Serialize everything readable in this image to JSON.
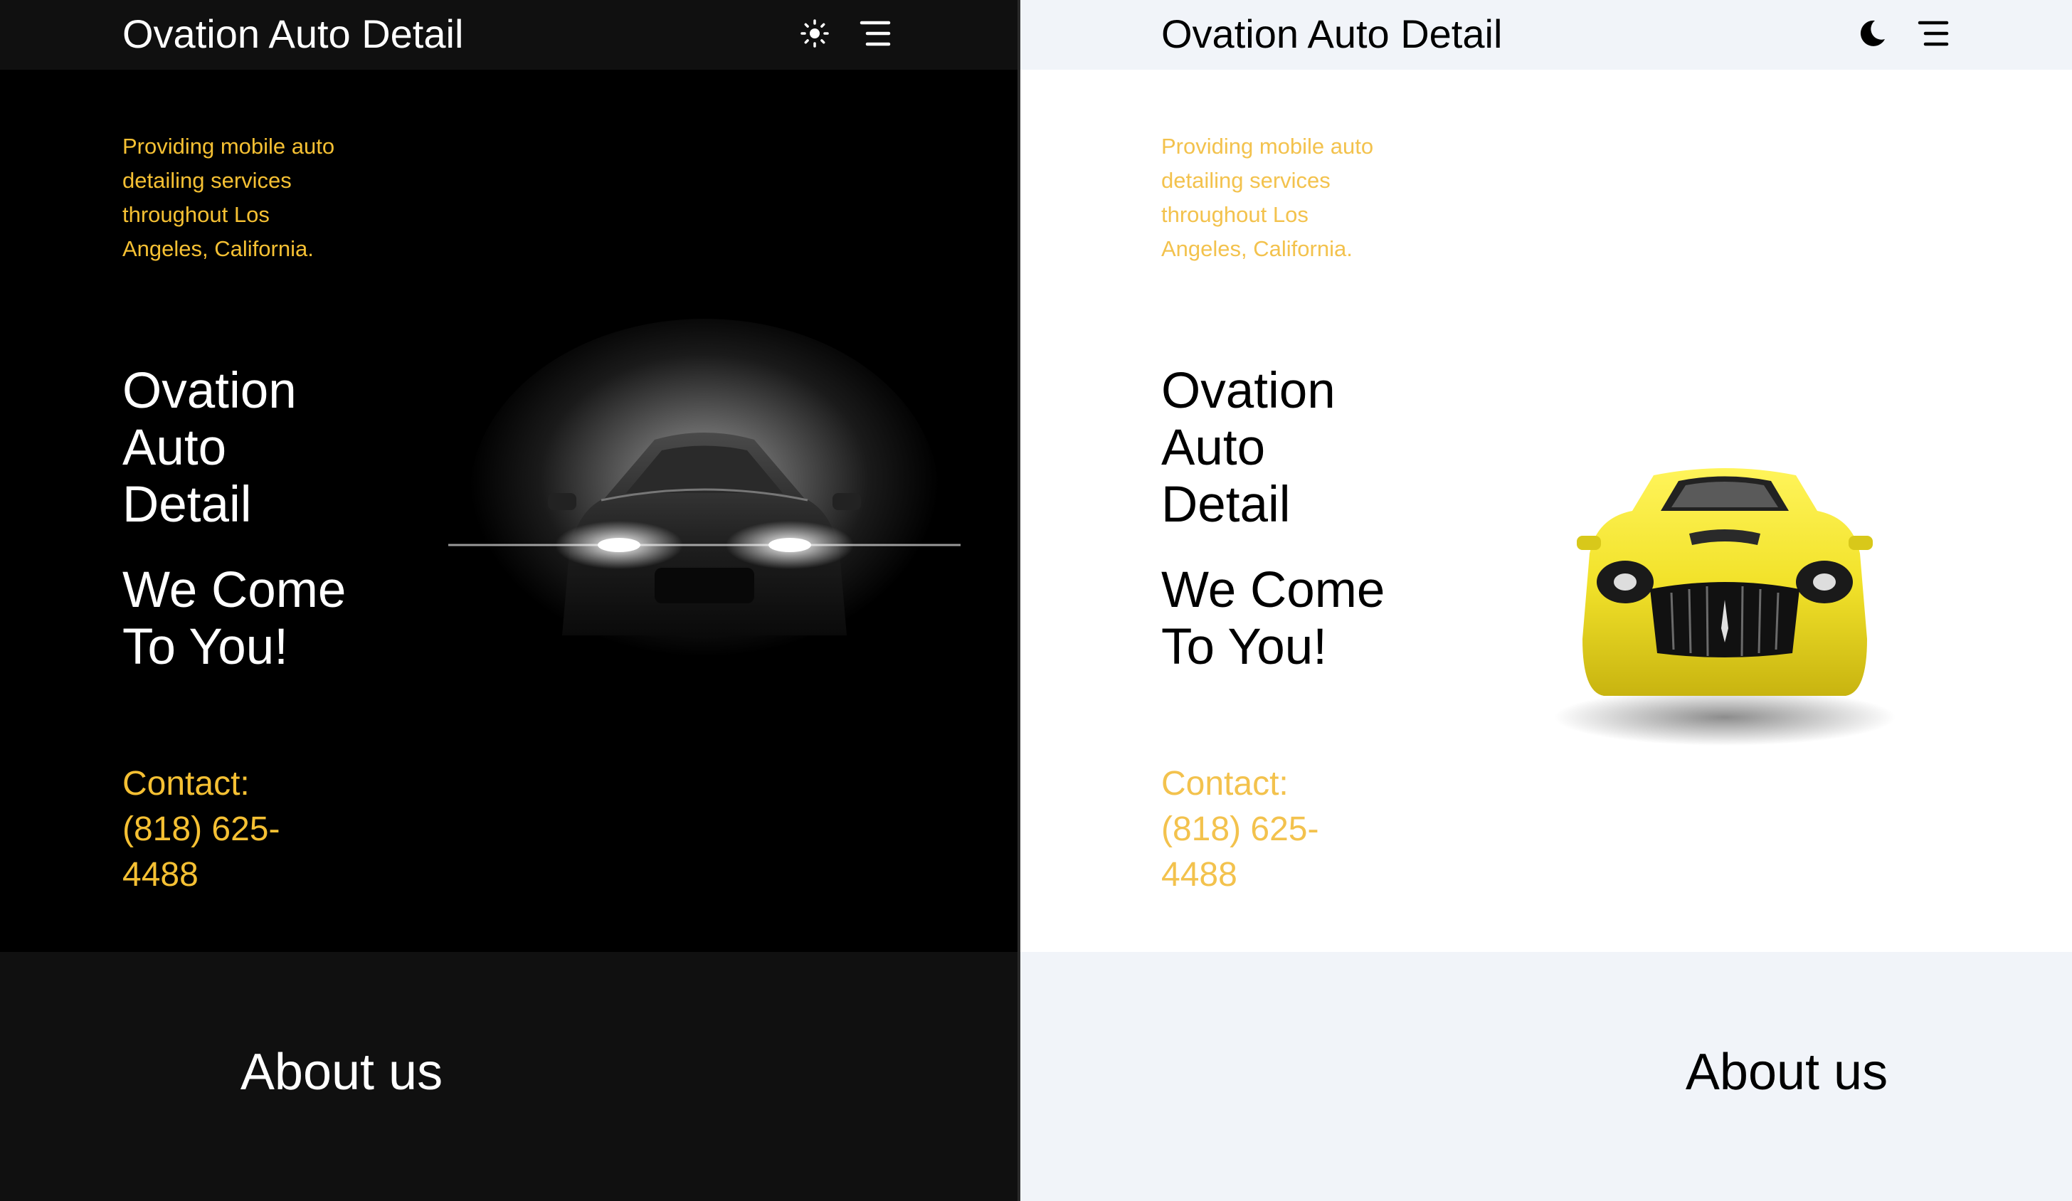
{
  "dark": {
    "brand": "Ovation Auto Detail",
    "theme_icon": "sun-icon",
    "menu_icon": "menu-icon",
    "tagline": "Providing mobile auto detailing services throughout Los Angeles, California.",
    "title": "Ovation Auto Detail",
    "subtitle": "We Come To You!",
    "contact": "Contact: (818) 625-4488",
    "hero_image": "dark-car-headlights-image",
    "about_title": "About us"
  },
  "light": {
    "brand": "Ovation Auto Detail",
    "theme_icon": "moon-icon",
    "menu_icon": "menu-icon",
    "tagline": "Providing mobile auto detailing services throughout Los Angeles, California.",
    "title": "Ovation Auto Detail",
    "subtitle": "We Come To You!",
    "contact": "Contact: (818) 625-4488",
    "hero_image": "yellow-sports-car-image",
    "about_title": "About us"
  },
  "colors": {
    "accent": "#f5c033",
    "dark_header": "#101010",
    "light_header": "#f1f4f9"
  }
}
